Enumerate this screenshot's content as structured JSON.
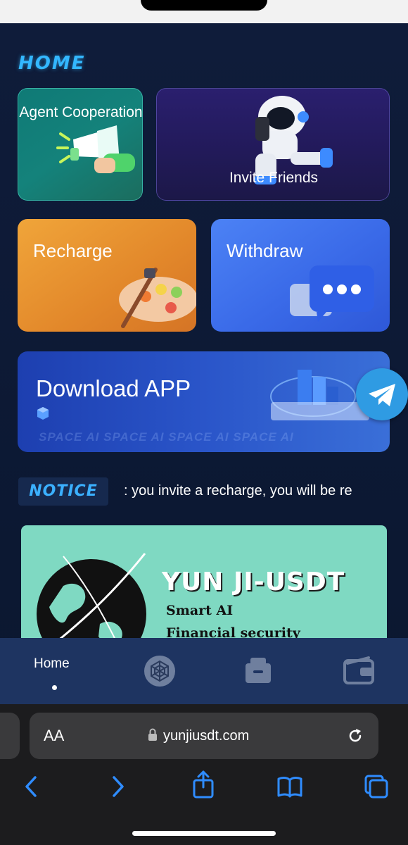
{
  "page": {
    "section_title": "HOME",
    "cards": {
      "agent": "Agent Cooperation",
      "invite": "Invite Friends",
      "recharge": "Recharge",
      "withdraw": "Withdraw",
      "download": "Download APP"
    },
    "download_watermark": "SPACE AI    SPACE AI    SPACE AI    SPACE AI",
    "notice_title": "NOTICE",
    "notice_text": ": you invite a recharge, you will be re",
    "banner": {
      "title": "YUN JI-USDT",
      "line1": "Smart AI",
      "line2": "Financial security"
    }
  },
  "tabbar": {
    "home_label": "Home"
  },
  "browser": {
    "aa_label": "AA",
    "url": "yunjiusdt.com"
  },
  "colors": {
    "accent": "#33b7ff",
    "background": "#0d1b33",
    "tabbar": "#1e3461"
  },
  "icons": [
    "megaphone-icon",
    "astronaut-icon",
    "palette-icon",
    "chat-bubble-icon",
    "telegram-icon",
    "spiderweb-icon",
    "mailbox-icon",
    "wallet-icon",
    "lock-icon",
    "reload-icon",
    "back-icon",
    "forward-icon",
    "share-icon",
    "bookmarks-icon",
    "tabs-icon"
  ]
}
